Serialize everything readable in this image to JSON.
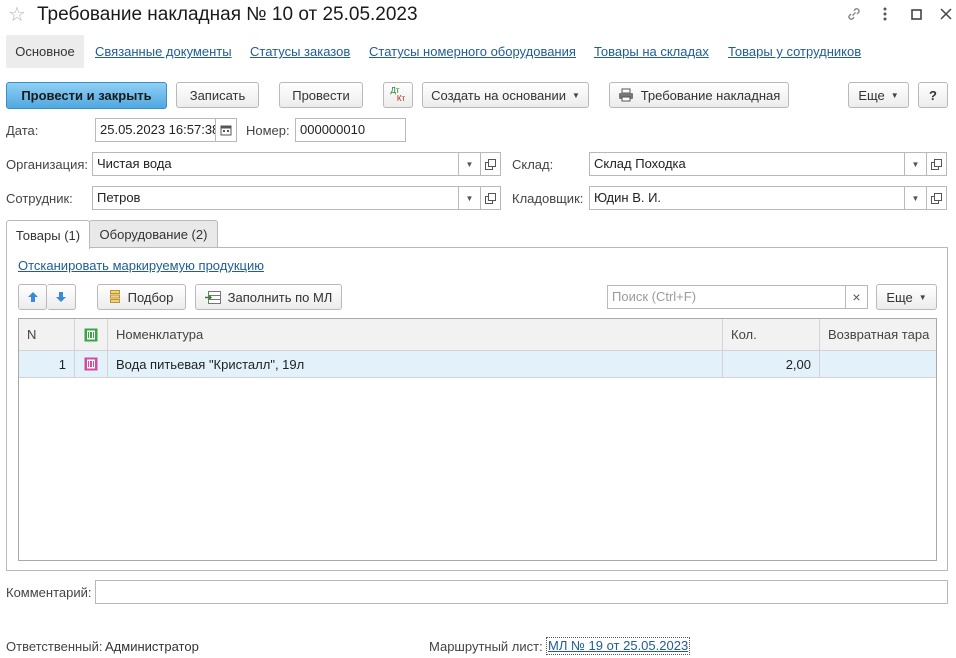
{
  "window": {
    "title": "Требование накладная № 10 от 25.05.2023",
    "star_icon": "star-icon",
    "controls": [
      "link-icon",
      "more-vertical-icon",
      "maximize-icon",
      "close-icon"
    ]
  },
  "nav": {
    "tabs": [
      {
        "label": "Основное",
        "active": true
      },
      {
        "label": "Связанные документы"
      },
      {
        "label": "Статусы заказов"
      },
      {
        "label": "Статусы номерного оборудования"
      },
      {
        "label": "Товары на складах"
      },
      {
        "label": "Товары у сотрудников"
      }
    ]
  },
  "toolbar": {
    "post_close": "Провести и закрыть",
    "save": "Записать",
    "post": "Провести",
    "dtkt_dt": "Дт",
    "dtkt_kt": "Кт",
    "create_based": "Создать на основании",
    "print": "Требование накладная",
    "more": "Еще",
    "help": "?"
  },
  "form": {
    "date_label": "Дата:",
    "date_value": "25.05.2023 16:57:38",
    "number_label": "Номер:",
    "number_value": "000000010",
    "org_label": "Организация:",
    "org_value": "Чистая вода",
    "warehouse_label": "Склад:",
    "warehouse_value": "Склад Походка",
    "employee_label": "Сотрудник:",
    "employee_value": "Петров",
    "storekeeper_label": "Кладовщик:",
    "storekeeper_value": "Юдин В. И."
  },
  "inner_tabs": [
    {
      "label": "Товары (1)",
      "active": true
    },
    {
      "label": "Оборудование (2)"
    }
  ],
  "goods": {
    "scan_link": "Отсканировать маркируемую продукцию",
    "pick_button": "Подбор",
    "fill_button": "Заполнить по МЛ",
    "search_placeholder": "Поиск (Ctrl+F)",
    "search_clear": "×",
    "more": "Еще",
    "columns": [
      "N",
      "",
      "Номенклатура",
      "Кол.",
      "Возвратная тара"
    ],
    "rows": [
      {
        "n": "1",
        "name": "Вода питьевая \"Кристалл\", 19л",
        "qty": "2,00",
        "tara": ""
      }
    ]
  },
  "comment": {
    "label": "Комментарий:",
    "value": ""
  },
  "footer": {
    "responsible_label": "Ответственный:",
    "responsible_value": "Администратор",
    "route_label": "Маршрутный лист:",
    "route_link": "МЛ № 19 от 25.05.2023"
  },
  "colors": {
    "primary_button": "#4fa8e0",
    "link": "#1f5c9a",
    "selected_row": "#e3f1fa",
    "up_down_arrows": "#3a8ad6"
  }
}
